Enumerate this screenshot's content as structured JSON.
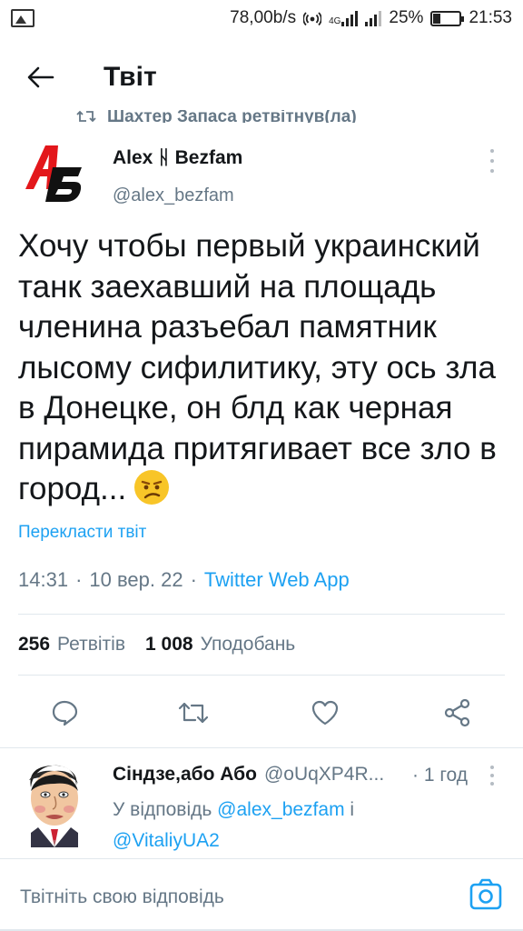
{
  "status_bar": {
    "speed": "78,00b/s",
    "network": "4G",
    "battery": "25%",
    "battery_level": 0.25,
    "time": "21:53"
  },
  "header": {
    "title": "Твіт",
    "back_icon": "arrow-left-icon"
  },
  "retweet_label": "Шахтер Запаса ретвітнув(ла)",
  "tweet": {
    "author_name": "Alex ᚺ Bezfam",
    "author_handle": "@alex_bezfam",
    "avatar_letters": "AB",
    "text": "Хочу чтобы первый украинский танк заехавший на площадь членина разъебал памятник лысому сифилитику, эту ось зла в Донецке, он блд как черная пирамида притягивает все зло в город...",
    "translate": "Перекласти твіт",
    "time": "14:31",
    "date": "10 вер. 22",
    "app": "Twitter Web App",
    "retweets_count": "256",
    "retweets_label": "Ретвітів",
    "likes_count": "1 008",
    "likes_label": "Уподобань"
  },
  "actions": [
    {
      "icon": "reply-icon"
    },
    {
      "icon": "retweet-icon"
    },
    {
      "icon": "like-icon"
    },
    {
      "icon": "share-icon"
    }
  ],
  "reply": {
    "author_name": "Сіндзе,або Або",
    "author_handle": "@oUqXP4R...",
    "time": "· 1 год",
    "reply_prefix": "У відповідь",
    "mention_1": "@alex_bezfam",
    "conjunction": "і",
    "mention_2": "@VitaliyUA2"
  },
  "compose": {
    "placeholder": "Твітніть свою відповідь",
    "camera_icon": "camera-icon"
  },
  "colors": {
    "accent": "#1da1f2",
    "secondary_text": "#657786",
    "primary_text": "#14171a",
    "divider": "#e1e8ed"
  }
}
